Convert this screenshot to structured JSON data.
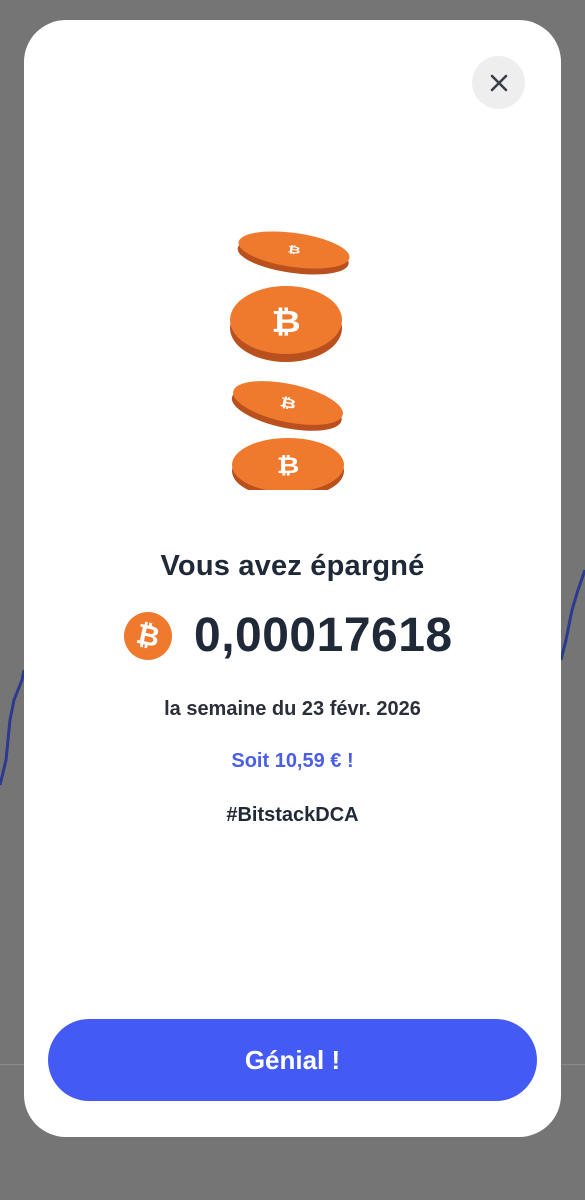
{
  "modal": {
    "close_icon": "close-icon",
    "illustration_icon": "bitcoin-coins-illustration",
    "title": "Vous avez épargné",
    "currency_icon": "bitcoin-icon",
    "amount": "0,00017618",
    "period": "la semaine du 23 févr. 2026",
    "fiat_equivalent": "Soit 10,59 € !",
    "hashtag": "#BitstackDCA",
    "primary_button_label": "Génial !"
  },
  "colors": {
    "backdrop": "#757575",
    "accent": "#435bf4",
    "fiat_text": "#4a5fe6",
    "bitcoin_orange": "#ef7a2e",
    "text_dark": "#1f2937"
  }
}
